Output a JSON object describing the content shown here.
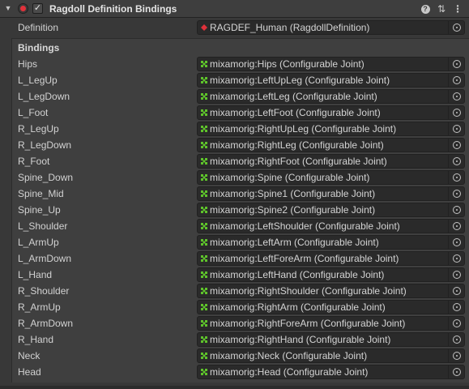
{
  "component": {
    "title": "Ragdoll Definition Bindings",
    "enabled": true,
    "foldout_glyph": "▼",
    "checkbox_glyph": "✓",
    "help_glyph": "?",
    "presets_glyph": "⇅",
    "menu_glyph": "⋮",
    "icons": {
      "component": "red-circle-icon",
      "definition": "red-diamond-icon",
      "binding": "green-joint-icon"
    },
    "colors": {
      "definition_icon": "#e0313a",
      "binding_icon": "#5ec32b"
    }
  },
  "definition": {
    "label": "Definition",
    "value": "RAGDEF_Human (RagdollDefinition)"
  },
  "bindings": {
    "label": "Bindings",
    "rows": [
      {
        "label": "Hips",
        "value": "mixamorig:Hips (Configurable Joint)"
      },
      {
        "label": "L_LegUp",
        "value": "mixamorig:LeftUpLeg (Configurable Joint)"
      },
      {
        "label": "L_LegDown",
        "value": "mixamorig:LeftLeg (Configurable Joint)"
      },
      {
        "label": "L_Foot",
        "value": "mixamorig:LeftFoot (Configurable Joint)"
      },
      {
        "label": "R_LegUp",
        "value": "mixamorig:RightUpLeg (Configurable Joint)"
      },
      {
        "label": "R_LegDown",
        "value": "mixamorig:RightLeg (Configurable Joint)"
      },
      {
        "label": "R_Foot",
        "value": "mixamorig:RightFoot (Configurable Joint)"
      },
      {
        "label": "Spine_Down",
        "value": "mixamorig:Spine (Configurable Joint)"
      },
      {
        "label": "Spine_Mid",
        "value": "mixamorig:Spine1 (Configurable Joint)"
      },
      {
        "label": "Spine_Up",
        "value": "mixamorig:Spine2 (Configurable Joint)"
      },
      {
        "label": "L_Shoulder",
        "value": "mixamorig:LeftShoulder (Configurable Joint)"
      },
      {
        "label": "L_ArmUp",
        "value": "mixamorig:LeftArm (Configurable Joint)"
      },
      {
        "label": "L_ArmDown",
        "value": "mixamorig:LeftForeArm (Configurable Joint)"
      },
      {
        "label": "L_Hand",
        "value": "mixamorig:LeftHand (Configurable Joint)"
      },
      {
        "label": "R_Shoulder",
        "value": "mixamorig:RightShoulder (Configurable Joint)"
      },
      {
        "label": "R_ArmUp",
        "value": "mixamorig:RightArm (Configurable Joint)"
      },
      {
        "label": "R_ArmDown",
        "value": "mixamorig:RightForeArm (Configurable Joint)"
      },
      {
        "label": "R_Hand",
        "value": "mixamorig:RightHand (Configurable Joint)"
      },
      {
        "label": "Neck",
        "value": "mixamorig:Neck (Configurable Joint)"
      },
      {
        "label": "Head",
        "value": "mixamorig:Head (Configurable Joint)"
      }
    ]
  }
}
